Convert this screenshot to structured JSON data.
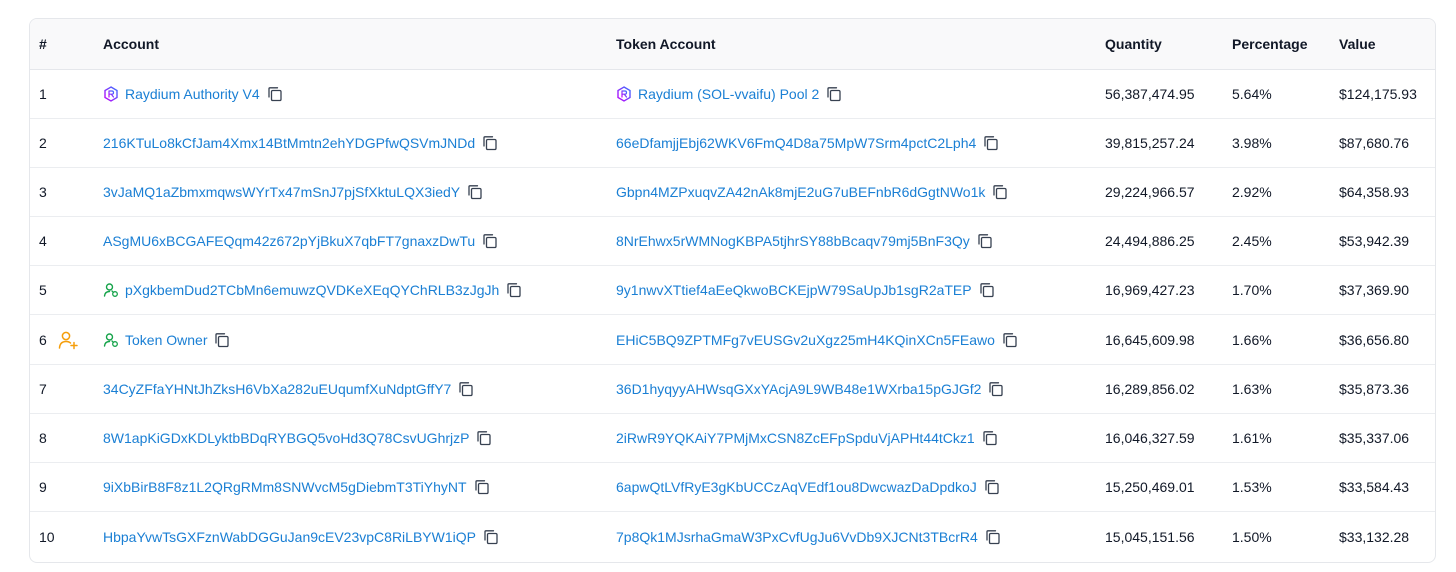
{
  "headers": {
    "index": "#",
    "account": "Account",
    "token_account": "Token Account",
    "quantity": "Quantity",
    "percentage": "Percentage",
    "value": "Value"
  },
  "colors": {
    "link": "#1a7fd4",
    "raydium_gradient": [
      "#c200fb",
      "#3772ff"
    ],
    "owner_icon": "#f59e0b",
    "wallet_icon": "#16a34a"
  },
  "rows": [
    {
      "index": "1",
      "account": "Raydium Authority V4",
      "account_icon": "raydium-icon",
      "token_account": "Raydium (SOL-vvaifu) Pool 2",
      "token_icon": "raydium-icon",
      "quantity": "56,387,474.95",
      "percentage": "5.64%",
      "value": "$124,175.93"
    },
    {
      "index": "2",
      "account": "216KTuLo8kCfJam4Xmx14BtMmtn2ehYDGPfwQSVmJNDd",
      "token_account": "66eDfamjjEbj62WKV6FmQ4D8a75MpW7Srm4pctC2Lph4",
      "quantity": "39,815,257.24",
      "percentage": "3.98%",
      "value": "$87,680.76"
    },
    {
      "index": "3",
      "account": "3vJaMQ1aZbmxmqwsWYrTx47mSnJ7pjSfXktuLQX3iedY",
      "token_account": "Gbpn4MZPxuqvZA42nAk8mjE2uG7uBEFnbR6dGgtNWo1k",
      "quantity": "29,224,966.57",
      "percentage": "2.92%",
      "value": "$64,358.93"
    },
    {
      "index": "4",
      "account": "ASgMU6xBCGAFEQqm42z672pYjBkuX7qbFT7gnaxzDwTu",
      "token_account": "8NrEhwx5rWMNogKBPA5tjhrSY88bBcaqv79mj5BnF3Qy",
      "quantity": "24,494,886.25",
      "percentage": "2.45%",
      "value": "$53,942.39"
    },
    {
      "index": "5",
      "account": "pXgkbemDud2TCbMn6emuwzQVDKeXEqQYChRLB3zJgJh",
      "account_icon": "wallet-icon",
      "token_account": "9y1nwvXTtief4aEeQkwoBCKEjpW79SaUpJb1sgR2aTEP",
      "quantity": "16,969,427.23",
      "percentage": "1.70%",
      "value": "$37,369.90"
    },
    {
      "index": "6",
      "owner": true,
      "account": "Token Owner",
      "account_icon": "wallet-icon",
      "token_account": "EHiC5BQ9ZPTMFg7vEUSGv2uXgz25mH4KQinXCn5FEawo",
      "quantity": "16,645,609.98",
      "percentage": "1.66%",
      "value": "$36,656.80"
    },
    {
      "index": "7",
      "account": "34CyZFfaYHNtJhZksH6VbXa282uEUqumfXuNdptGffY7",
      "token_account": "36D1hyqyyAHWsqGXxYAcjA9L9WB48e1WXrba15pGJGf2",
      "quantity": "16,289,856.02",
      "percentage": "1.63%",
      "value": "$35,873.36"
    },
    {
      "index": "8",
      "account": "8W1apKiGDxKDLyktbBDqRYBGQ5voHd3Q78CsvUGhrjzP",
      "token_account": "2iRwR9YQKAiY7PMjMxCSN8ZcEFpSpduVjAPHt44tCkz1",
      "quantity": "16,046,327.59",
      "percentage": "1.61%",
      "value": "$35,337.06"
    },
    {
      "index": "9",
      "account": "9iXbBirB8F8z1L2QRgRMm8SNWvcM5gDiebmT3TiYhyNT",
      "token_account": "6apwQtLVfRyE3gKbUCCzAqVEdf1ou8DwcwazDaDpdkoJ",
      "quantity": "15,250,469.01",
      "percentage": "1.53%",
      "value": "$33,584.43"
    },
    {
      "index": "10",
      "account": "HbpaYvwTsGXFznWabDGGuJan9cEV23vpC8RiLBYW1iQP",
      "token_account": "7p8Qk1MJsrhaGmaW3PxCvfUgJu6VvDb9XJCNt3TBcrR4",
      "quantity": "15,045,151.56",
      "percentage": "1.50%",
      "value": "$33,132.28"
    }
  ]
}
